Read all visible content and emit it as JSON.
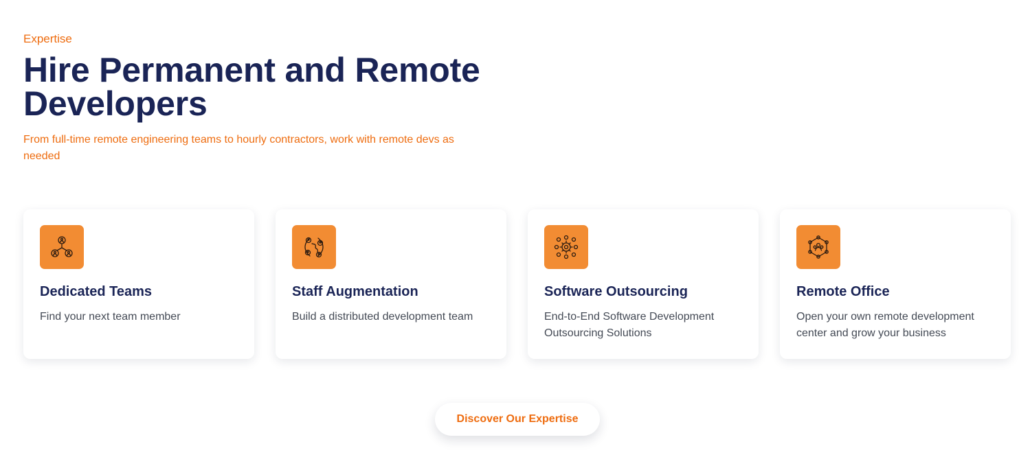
{
  "section": {
    "eyebrow": "Expertise",
    "title": "Hire Permanent and Remote Developers",
    "subtitle": "From full-time remote engineering teams to hourly contractors, work with remote devs as needed"
  },
  "cards": [
    {
      "icon": "team-network-icon",
      "title": "Dedicated Teams",
      "description": "Find your next team member"
    },
    {
      "icon": "global-staff-icon",
      "title": "Staff Augmentation",
      "description": "Build a distributed development team"
    },
    {
      "icon": "outsourcing-gear-icon",
      "title": "Software Outsourcing",
      "description": "End-to-End Software Development Outsourcing Solutions"
    },
    {
      "icon": "remote-office-network-icon",
      "title": "Remote Office",
      "description": "Open your own remote development center and grow your business"
    }
  ],
  "cta": {
    "label": "Discover Our Expertise"
  },
  "colors": {
    "accent": "#ee6c0f",
    "icon_tile": "#f28c33",
    "heading": "#1a2456",
    "body_text": "#444a55"
  }
}
